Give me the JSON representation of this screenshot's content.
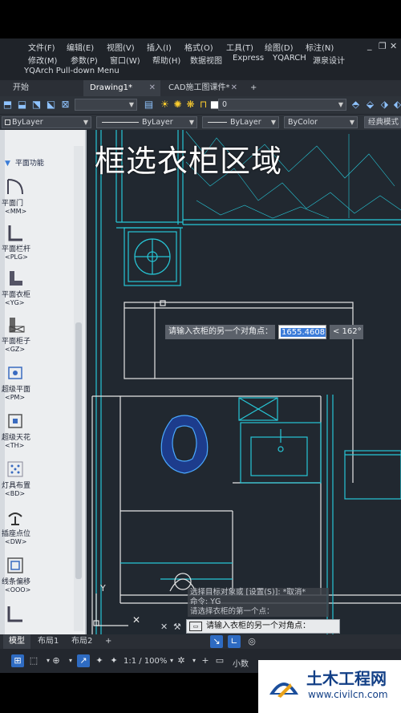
{
  "menu": {
    "row1": [
      "文件(F)",
      "编辑(E)",
      "视图(V)",
      "插入(I)",
      "格式(O)",
      "工具(T)",
      "绘图(D)",
      "标注(N)"
    ],
    "row2": [
      "修改(M)",
      "参数(P)",
      "窗口(W)",
      "帮助(H)",
      "数据视图",
      "Express",
      "YQARCH",
      "源泉设计"
    ],
    "row3": "YQArch Pull-down Menu"
  },
  "window_controls": [
    "_",
    "❐",
    "✕"
  ],
  "doc_tabs": [
    {
      "label": "开始",
      "active": false
    },
    {
      "label": "Drawing1*",
      "active": true
    },
    {
      "label": "CAD施工图课件*",
      "active": false
    }
  ],
  "new_tab_symbol": "+",
  "layer_combo": "0",
  "properties": {
    "color": "ByLayer",
    "linetype": "ByLayer",
    "lineweight": "ByLayer",
    "plotstyle": "ByColor",
    "workspace": "经典模式"
  },
  "palette": {
    "title": "平面功能",
    "items": [
      {
        "label": "平面门",
        "cmd": "<MM>",
        "icon": "door-icon"
      },
      {
        "label": "平面栏杆",
        "cmd": "<PLG>",
        "icon": "railing-icon"
      },
      {
        "label": "平面衣柜",
        "cmd": "<YG>",
        "icon": "wardrobe-icon"
      },
      {
        "label": "平面柜子",
        "cmd": "<GZ>",
        "icon": "cabinet-icon"
      },
      {
        "label": "超级平面",
        "cmd": "<PM>",
        "icon": "super-plan-icon"
      },
      {
        "label": "超级天花",
        "cmd": "<TH>",
        "icon": "ceiling-icon"
      },
      {
        "label": "灯具布置",
        "cmd": "<BD>",
        "icon": "lamp-icon"
      },
      {
        "label": "插座点位",
        "cmd": "<DW>",
        "icon": "socket-icon"
      },
      {
        "label": "线条偏移",
        "cmd": "<OOO>",
        "icon": "offset-icon"
      }
    ]
  },
  "overlay_title": "框选衣柜区域",
  "dynamic_input": {
    "prompt": "请输入衣柜的另一个对角点：",
    "value": "1655.4608",
    "angle": "< 162°"
  },
  "command_history": [
    "选择目标对象或 [设置(S)]: *取消*",
    "命令: YG",
    "请选择衣柜的第一个点："
  ],
  "command_line": "请输入衣柜的另一个对角点：",
  "layout_tabs": [
    {
      "label": "模型",
      "active": true
    },
    {
      "label": "布局1",
      "active": false
    },
    {
      "label": "布局2",
      "active": false
    }
  ],
  "status": {
    "scale": "1:1 / 100%",
    "decimal": "小数"
  },
  "ucs_label": "Y",
  "watermark": {
    "title": "土木工程网",
    "url": "www.civilcn.com"
  },
  "colors": {
    "canvas": "#212830",
    "cyan_lines": "#27c6d6",
    "white_lines": "#e6e6e6",
    "accent_blue": "#2e6bc2"
  }
}
